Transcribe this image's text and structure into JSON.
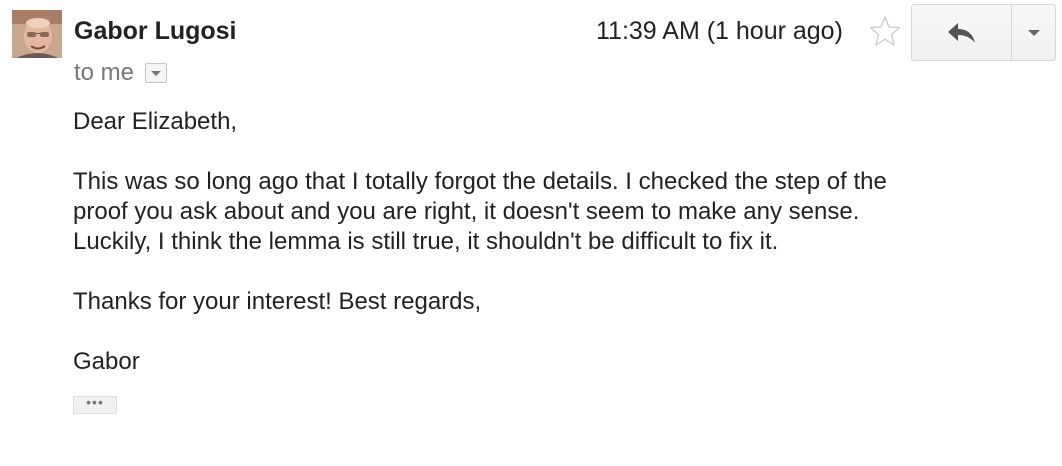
{
  "message": {
    "sender": {
      "name": "Gabor Lugosi",
      "avatar": "profile-photo"
    },
    "recipient_label": "to me",
    "timestamp": "11:39 AM (1 hour ago)",
    "starred": false,
    "icons": {
      "star": "star-outline-icon",
      "reply": "reply-arrow-icon",
      "more": "chevron-down-icon",
      "details": "details-dropdown-icon"
    },
    "body": {
      "greeting": "Dear Elizabeth,",
      "paragraph_lines": [
        "This was so long ago that I totally forgot the details. I checked the step of the",
        "proof you ask about and you are right, it doesn't seem to make any sense.",
        "Luckily, I think the lemma is still true, it shouldn't be difficult to fix it."
      ],
      "closing": "Thanks for your interest! Best regards,",
      "signature": "Gabor"
    },
    "trimmed_content_label": "•••"
  },
  "colors": {
    "text": "#222222",
    "muted": "#777777",
    "button_border": "#d6d6d6",
    "button_bg": "#f1f1f1"
  }
}
